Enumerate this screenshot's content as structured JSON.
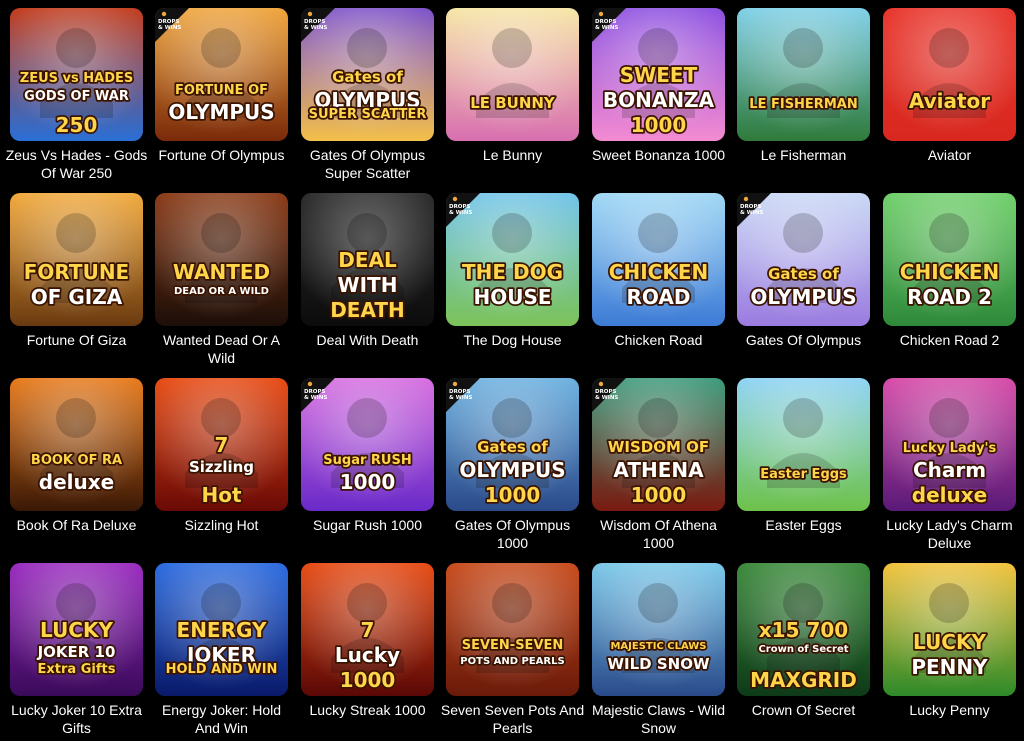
{
  "badge": {
    "line1": "DROPS",
    "line2": "& WINS"
  },
  "games": [
    {
      "title": "Zeus Vs Hades - Gods Of War 250",
      "art": [
        "ZEUS vs HADES",
        "GODS OF WAR",
        "250"
      ],
      "bg": [
        "#c23a1a",
        "#2a6fd6"
      ],
      "dw": false
    },
    {
      "title": "Fortune Of Olympus",
      "art": [
        "FORTUNE OF",
        "OLYMPUS"
      ],
      "bg": [
        "#f0a43a",
        "#7a2a0a"
      ],
      "dw": true
    },
    {
      "title": "Gates Of Olympus Super Scatter",
      "art": [
        "Gates of",
        "OLYMPUS",
        "SUPER SCATTER"
      ],
      "bg": [
        "#7b4fc9",
        "#f3c04a"
      ],
      "dw": true
    },
    {
      "title": "Le Bunny",
      "art": [
        "LE BUNNY"
      ],
      "bg": [
        "#f6e6a6",
        "#d86fb0"
      ],
      "dw": false
    },
    {
      "title": "Sweet Bonanza 1000",
      "art": [
        "SWEET",
        "BONANZA",
        "1000"
      ],
      "bg": [
        "#8a4de0",
        "#f38bd1"
      ],
      "dw": true
    },
    {
      "title": "Le Fisherman",
      "art": [
        "LE FISHERMAN"
      ],
      "bg": [
        "#7fd0e8",
        "#2f7a3a"
      ],
      "dw": false
    },
    {
      "title": "Aviator",
      "art": [
        "Aviator"
      ],
      "bg": [
        "#e8342a",
        "#d8281f"
      ],
      "dw": false
    },
    {
      "title": "Fortune Of Giza",
      "art": [
        "FORTUNE",
        "OF GIZA"
      ],
      "bg": [
        "#f2a93b",
        "#6a3a10"
      ],
      "dw": false
    },
    {
      "title": "Wanted Dead Or A Wild",
      "art": [
        "WANTED",
        "DEAD OR A WILD"
      ],
      "bg": [
        "#8a3a16",
        "#1c0e08"
      ],
      "dw": false
    },
    {
      "title": "Deal With Death",
      "art": [
        "DEAL",
        "WITH",
        "DEATH"
      ],
      "bg": [
        "#2a2a2a",
        "#0c0c0c"
      ],
      "dw": false
    },
    {
      "title": "The Dog House",
      "art": [
        "THE DOG",
        "HOUSE"
      ],
      "bg": [
        "#6fc3ea",
        "#7cc35a"
      ],
      "dw": true
    },
    {
      "title": "Chicken Road",
      "art": [
        "CHICKEN",
        "ROAD"
      ],
      "bg": [
        "#9fd8f5",
        "#3d7bd6"
      ],
      "dw": false
    },
    {
      "title": "Gates Of Olympus",
      "art": [
        "Gates of",
        "OLYMPUS"
      ],
      "bg": [
        "#c9d8f5",
        "#9b7be0"
      ],
      "dw": true
    },
    {
      "title": "Chicken Road 2",
      "art": [
        "CHICKEN",
        "ROAD 2"
      ],
      "bg": [
        "#6fcf6a",
        "#2e8a3a"
      ],
      "dw": false
    },
    {
      "title": "Book Of Ra Deluxe",
      "art": [
        "BOOK OF RA",
        "deluxe"
      ],
      "bg": [
        "#e87a1a",
        "#3a1806"
      ],
      "dw": false
    },
    {
      "title": "Sizzling Hot",
      "art": [
        "7",
        "Sizzling",
        "Hot"
      ],
      "bg": [
        "#e84a12",
        "#6a0a06"
      ],
      "dw": false
    },
    {
      "title": "Sugar Rush 1000",
      "art": [
        "Sugar RUSH",
        "1000"
      ],
      "bg": [
        "#d66ee0",
        "#6a2ac8"
      ],
      "dw": true
    },
    {
      "title": "Gates Of Olympus 1000",
      "art": [
        "Gates of",
        "OLYMPUS",
        "1000"
      ],
      "bg": [
        "#6ab0e0",
        "#2b4a8a"
      ],
      "dw": true
    },
    {
      "title": "Wisdom Of Athena 1000",
      "art": [
        "WISDOM OF",
        "ATHENA",
        "1000"
      ],
      "bg": [
        "#3a9a7a",
        "#7a1a10"
      ],
      "dw": true
    },
    {
      "title": "Easter Eggs",
      "art": [
        "Easter Eggs"
      ],
      "bg": [
        "#8ed3f5",
        "#6ec24a"
      ],
      "dw": false
    },
    {
      "title": "Lucky Lady's Charm Deluxe",
      "art": [
        "Lucky Lady's",
        "Charm",
        "deluxe"
      ],
      "bg": [
        "#d64aa8",
        "#5a1a78"
      ],
      "dw": false
    },
    {
      "title": "Lucky Joker 10 Extra Gifts",
      "art": [
        "LUCKY",
        "JOKER 10",
        "Extra Gifts"
      ],
      "bg": [
        "#9a2ac0",
        "#3a0a5a"
      ],
      "dw": false
    },
    {
      "title": "Energy Joker: Hold And Win",
      "art": [
        "ENERGY",
        "JOKER",
        "HOLD AND WIN"
      ],
      "bg": [
        "#2a6ae0",
        "#0a1a6a"
      ],
      "dw": false
    },
    {
      "title": "Lucky Streak 1000",
      "art": [
        "7",
        "Lucky",
        "1000"
      ],
      "bg": [
        "#e84a12",
        "#5a0806"
      ],
      "dw": false
    },
    {
      "title": "Seven Seven Pots And Pearls",
      "art": [
        "SEVEN-SEVEN",
        "POTS AND PEARLS"
      ],
      "bg": [
        "#c84a1a",
        "#6a1a0a"
      ],
      "dw": false
    },
    {
      "title": "Majestic Claws - Wild Snow",
      "art": [
        "MAJESTIC CLAWS",
        "WILD SNOW"
      ],
      "bg": [
        "#7ac8ea",
        "#2a4a8a"
      ],
      "dw": false
    },
    {
      "title": "Crown Of Secret",
      "art": [
        "x15 700",
        "Crown of Secret",
        "MAXGRID"
      ],
      "bg": [
        "#3a8a3a",
        "#0e3a18"
      ],
      "dw": false
    },
    {
      "title": "Lucky Penny",
      "art": [
        "LUCKY",
        "PENNY"
      ],
      "bg": [
        "#f2c23a",
        "#2e8a2a"
      ],
      "dw": false
    }
  ]
}
